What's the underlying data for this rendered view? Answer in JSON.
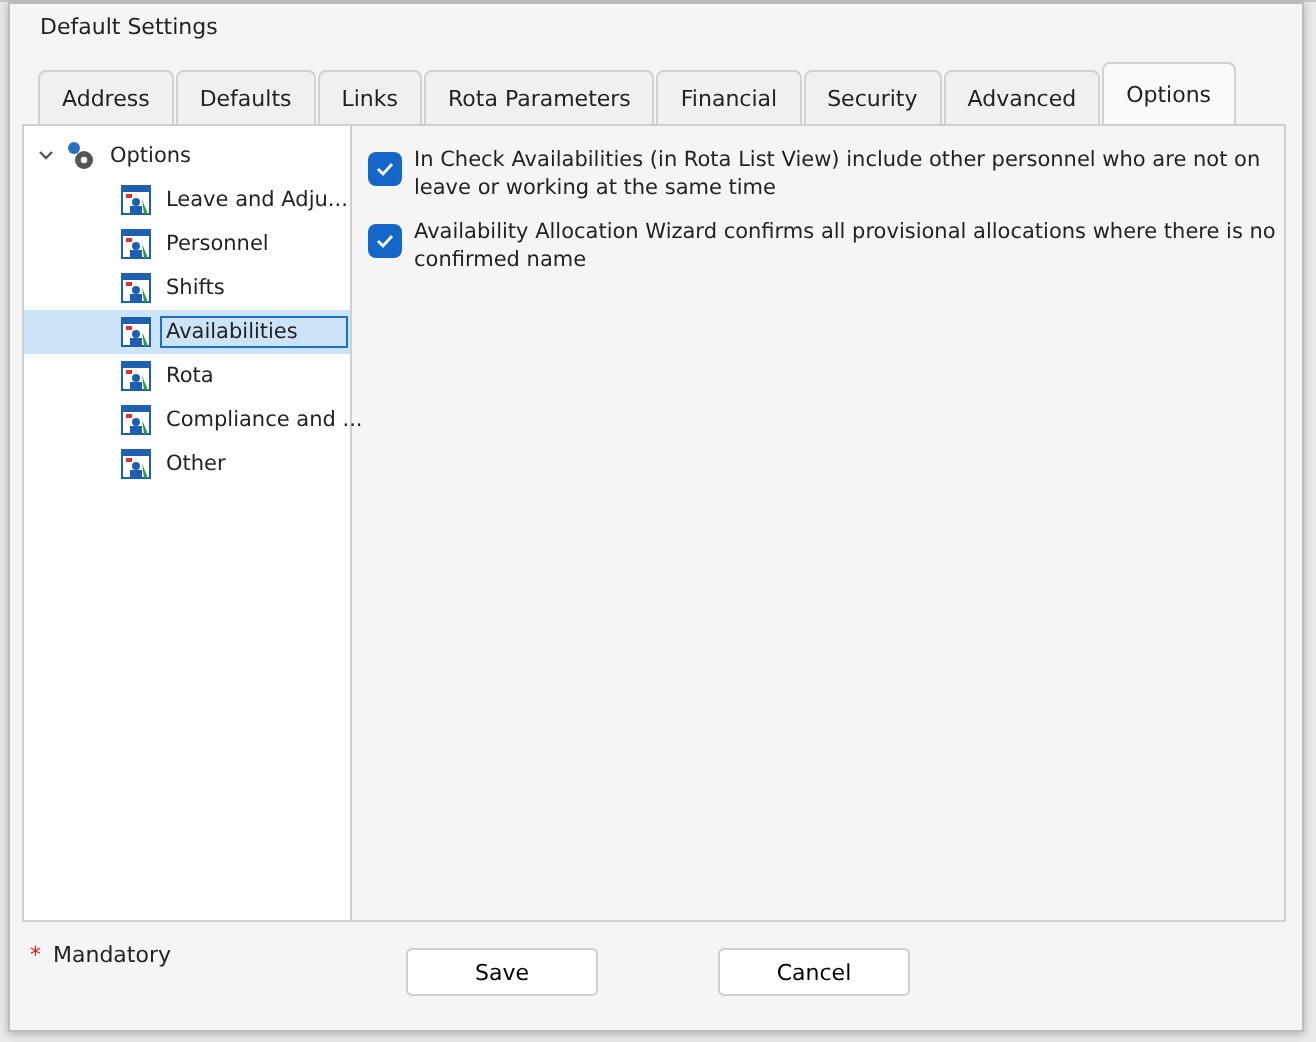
{
  "window": {
    "title": "Default Settings"
  },
  "tabs": [
    {
      "label": "Address",
      "selected": false
    },
    {
      "label": "Defaults",
      "selected": false
    },
    {
      "label": "Links",
      "selected": false
    },
    {
      "label": "Rota Parameters",
      "selected": false
    },
    {
      "label": "Financial",
      "selected": false
    },
    {
      "label": "Security",
      "selected": false
    },
    {
      "label": "Advanced",
      "selected": false
    },
    {
      "label": "Options",
      "selected": true
    }
  ],
  "tree": {
    "label": "Options",
    "expanded": true,
    "children": [
      {
        "label": "Leave and Adju...",
        "selected": false
      },
      {
        "label": "Personnel",
        "selected": false
      },
      {
        "label": "Shifts",
        "selected": false
      },
      {
        "label": "Availabilities",
        "selected": true
      },
      {
        "label": "Rota",
        "selected": false
      },
      {
        "label": "Compliance and ...",
        "selected": false
      },
      {
        "label": "Other",
        "selected": false
      }
    ]
  },
  "options": [
    {
      "label": "In Check Availabilities (in Rota List View) include other personnel who are not on leave or working at the same time",
      "checked": true
    },
    {
      "label": "Availability Allocation Wizard confirms all provisional allocations where there is no confirmed name",
      "checked": true
    }
  ],
  "mandatory": {
    "mark": "*",
    "label": "Mandatory"
  },
  "buttons": [
    "Save",
    "Cancel"
  ]
}
